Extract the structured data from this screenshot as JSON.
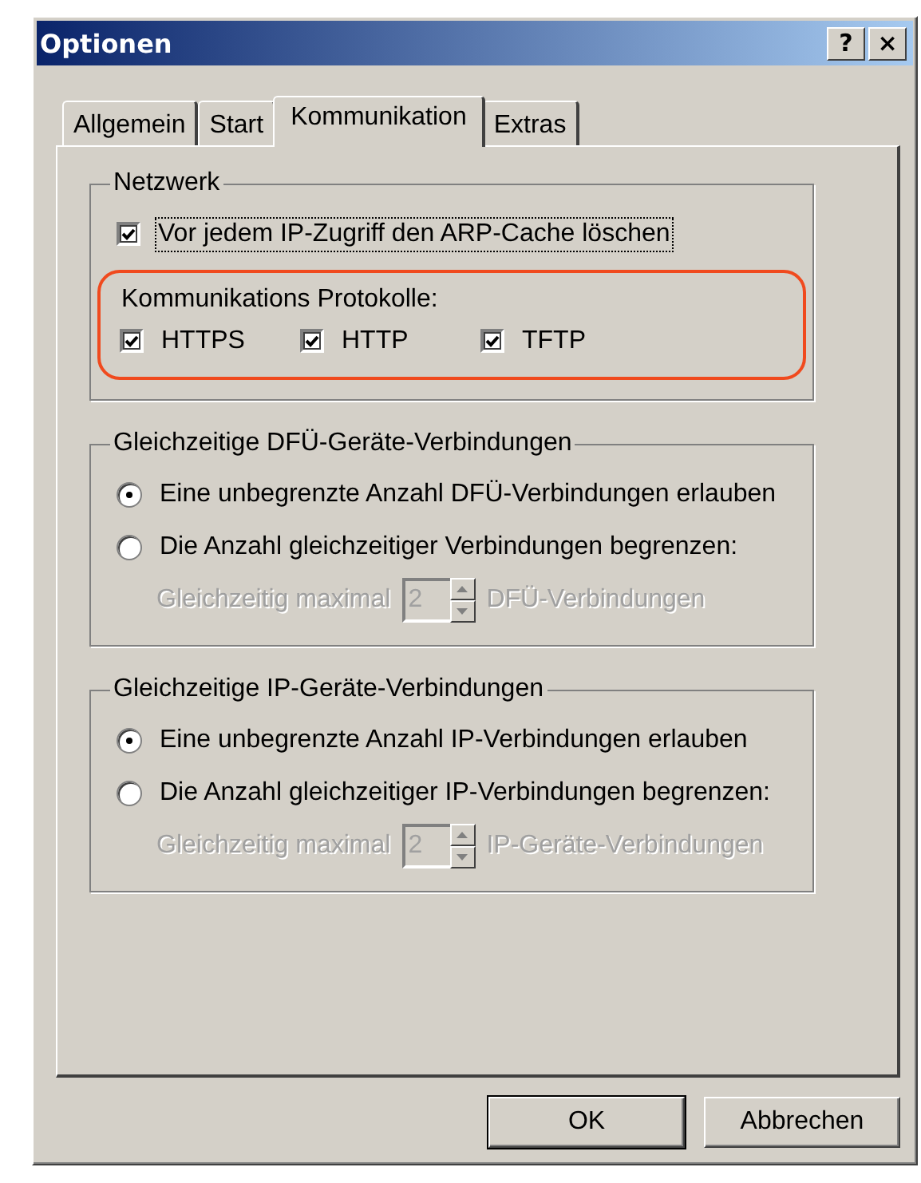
{
  "window": {
    "title": "Optionen",
    "title_buttons": [
      "?",
      "×"
    ]
  },
  "tabs": [
    {
      "label": "Allgemein",
      "selected": false
    },
    {
      "label": "Start",
      "selected": false
    },
    {
      "label": "Kommunikation",
      "selected": true
    },
    {
      "label": "Extras",
      "selected": false
    }
  ],
  "network": {
    "title": "Netzwerk",
    "arp_checkbox": {
      "label": "Vor jedem IP-Zugriff den ARP-Cache löschen",
      "checked": true,
      "focused": true
    },
    "protocols": {
      "label": "Kommunikations Protokolle:",
      "highlighted": true,
      "items": [
        {
          "label": "HTTPS",
          "checked": true
        },
        {
          "label": "HTTP",
          "checked": true
        },
        {
          "label": "TFTP",
          "checked": true
        }
      ]
    }
  },
  "groups": [
    {
      "title": "Gleichzeitige DFÜ-Geräte-Verbindungen",
      "options": [
        {
          "label": "Eine unbegrenzte Anzahl DFÜ-Verbindungen erlauben",
          "selected": true
        },
        {
          "label": "Die Anzahl gleichzeitiger Verbindungen begrenzen:",
          "selected": false
        }
      ],
      "limit": {
        "label": "Gleichzeitig maximal",
        "value": "2",
        "suffix": "DFÜ-Verbindungen",
        "disabled": true
      }
    },
    {
      "title": "Gleichzeitige IP-Geräte-Verbindungen",
      "options": [
        {
          "label": "Eine unbegrenzte Anzahl IP-Verbindungen erlauben",
          "selected": true
        },
        {
          "label": "Die Anzahl gleichzeitiger IP-Verbindungen begrenzen:",
          "selected": false
        }
      ],
      "limit": {
        "label": "Gleichzeitig maximal",
        "value": "2",
        "suffix": "IP-Geräte-Verbindungen",
        "disabled": true
      }
    }
  ],
  "buttons": [
    {
      "label": "OK",
      "default": true
    },
    {
      "label": "Abbrechen",
      "default": false
    }
  ]
}
